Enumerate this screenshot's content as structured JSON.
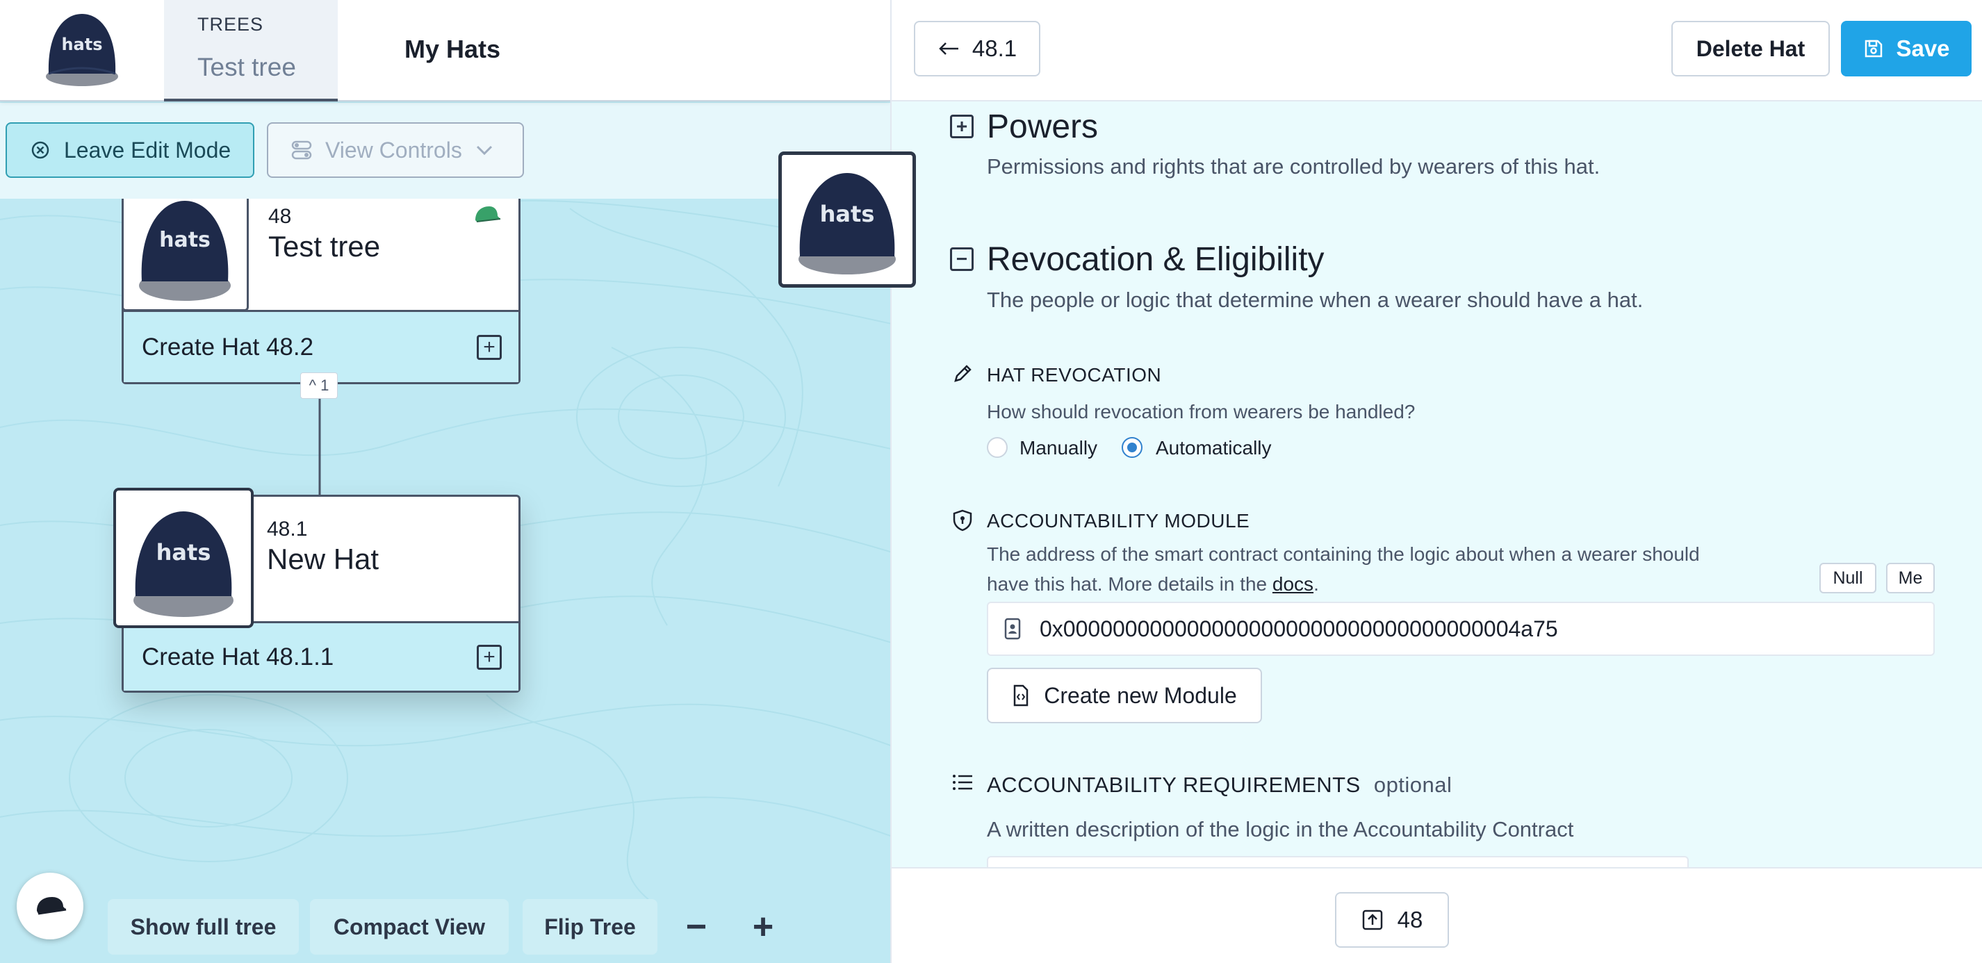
{
  "app": {
    "logo_text": "hats"
  },
  "header": {
    "trees_kicker": "TREES",
    "tree_name": "Test tree",
    "my_hats": "My Hats"
  },
  "controls": {
    "leave_edit": "Leave Edit Mode",
    "view_controls": "View Controls"
  },
  "tree": {
    "parent": {
      "id": "48",
      "name": "Test tree",
      "create_label": "Create Hat 48.2"
    },
    "collapse_tag": "^ 1",
    "child": {
      "id": "48.1",
      "name": "New Hat",
      "create_label": "Create Hat 48.1.1"
    }
  },
  "bottom_controls": {
    "show_full_tree": "Show full tree",
    "compact_view": "Compact View",
    "flip_tree": "Flip Tree",
    "zoom_out": "−",
    "zoom_in": "+"
  },
  "detail": {
    "back_label": "48.1",
    "delete_label": "Delete Hat",
    "save_label": "Save",
    "powers": {
      "toggle": "+",
      "title": "Powers",
      "description": "Permissions and rights that are controlled by wearers of this hat."
    },
    "revocation": {
      "toggle": "−",
      "title": "Revocation & Eligibility",
      "description": "The people or logic that determine when a wearer should have a hat."
    },
    "hat_revocation": {
      "label": "HAT REVOCATION",
      "question": "How should revocation from wearers be handled?",
      "options": [
        "Manually",
        "Automatically"
      ],
      "selected": "Automatically"
    },
    "accountability_module": {
      "label": "ACCOUNTABILITY MODULE",
      "description_1": "The address of the smart contract containing the logic about when a wearer should",
      "description_2": "have this hat. More details in the",
      "docs_link": "docs",
      "description_end": ".",
      "null_btn": "Null",
      "me_btn": "Me",
      "address": "0x0000000000000000000000000000000000004a75",
      "create_module": "Create new Module"
    },
    "accountability_requirements": {
      "label": "ACCOUNTABILITY REQUIREMENTS",
      "optional": "optional",
      "description": "A written description of the logic in the Accountability Contract"
    },
    "parent_nav": "48"
  },
  "colors": {
    "accent": "#20a4e7",
    "canvas": "#bfe9f3",
    "panel": "#eafbfd",
    "hat_navy": "#1e2a4a"
  }
}
